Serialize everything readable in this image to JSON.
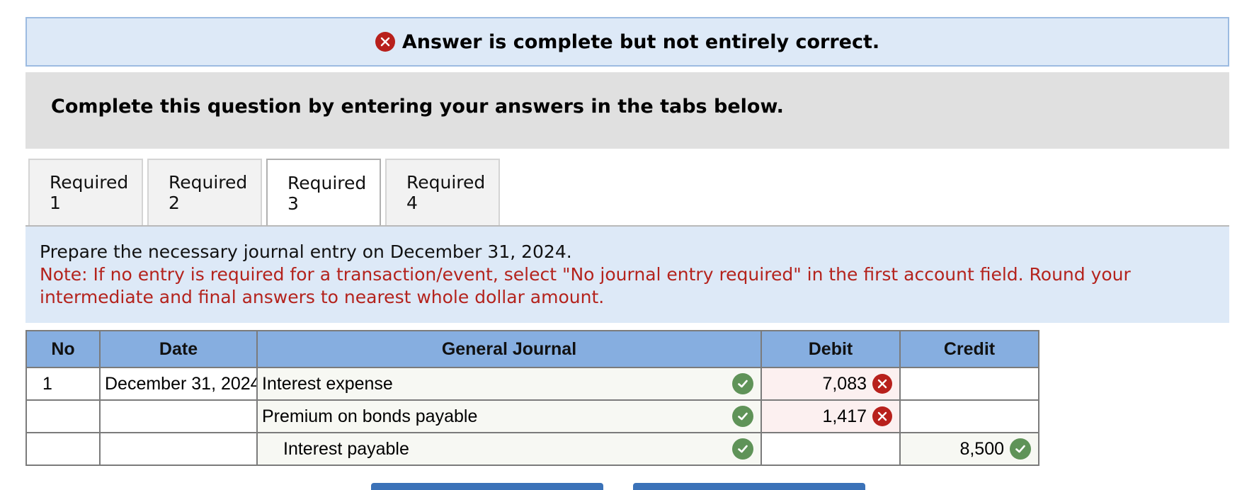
{
  "banner": {
    "message": "Answer is complete but not entirely correct.",
    "status_icon": "x-circle-icon",
    "status_color": "#b8201c"
  },
  "instruction": {
    "text": "Complete this question by entering your answers in the tabs below."
  },
  "tabs": [
    {
      "label": "Required 1",
      "active": false
    },
    {
      "label": "Required 2",
      "active": false
    },
    {
      "label": "Required 3",
      "active": true
    },
    {
      "label": "Required 4",
      "active": false
    }
  ],
  "prompt": {
    "main": "Prepare the necessary journal entry on December 31, 2024.",
    "note_line1": "Note: If no entry is required for a transaction/event, select \"No journal entry required\" in the first account field. Round your",
    "note_line2": "intermediate and final answers to nearest whole dollar amount."
  },
  "journal": {
    "headers": {
      "no": "No",
      "date": "Date",
      "general_journal": "General Journal",
      "debit": "Debit",
      "credit": "Credit"
    },
    "rows": [
      {
        "no": "1",
        "date": "December 31, 2024",
        "account": "Interest expense",
        "debit": "7,083",
        "credit": "",
        "account_status": "correct",
        "amount_status": "incorrect"
      },
      {
        "no": "",
        "date": "",
        "account": "Premium on bonds payable",
        "debit": "1,417",
        "credit": "",
        "account_status": "correct",
        "amount_status": "incorrect"
      },
      {
        "no": "",
        "date": "",
        "account": "Interest payable",
        "debit": "",
        "credit": "8,500",
        "account_status": "correct",
        "amount_status": "correct"
      }
    ]
  },
  "colors": {
    "correct": "#5f9358",
    "incorrect": "#b8201c",
    "header_bg": "#86aee0",
    "panel_bg": "#dde9f7"
  }
}
